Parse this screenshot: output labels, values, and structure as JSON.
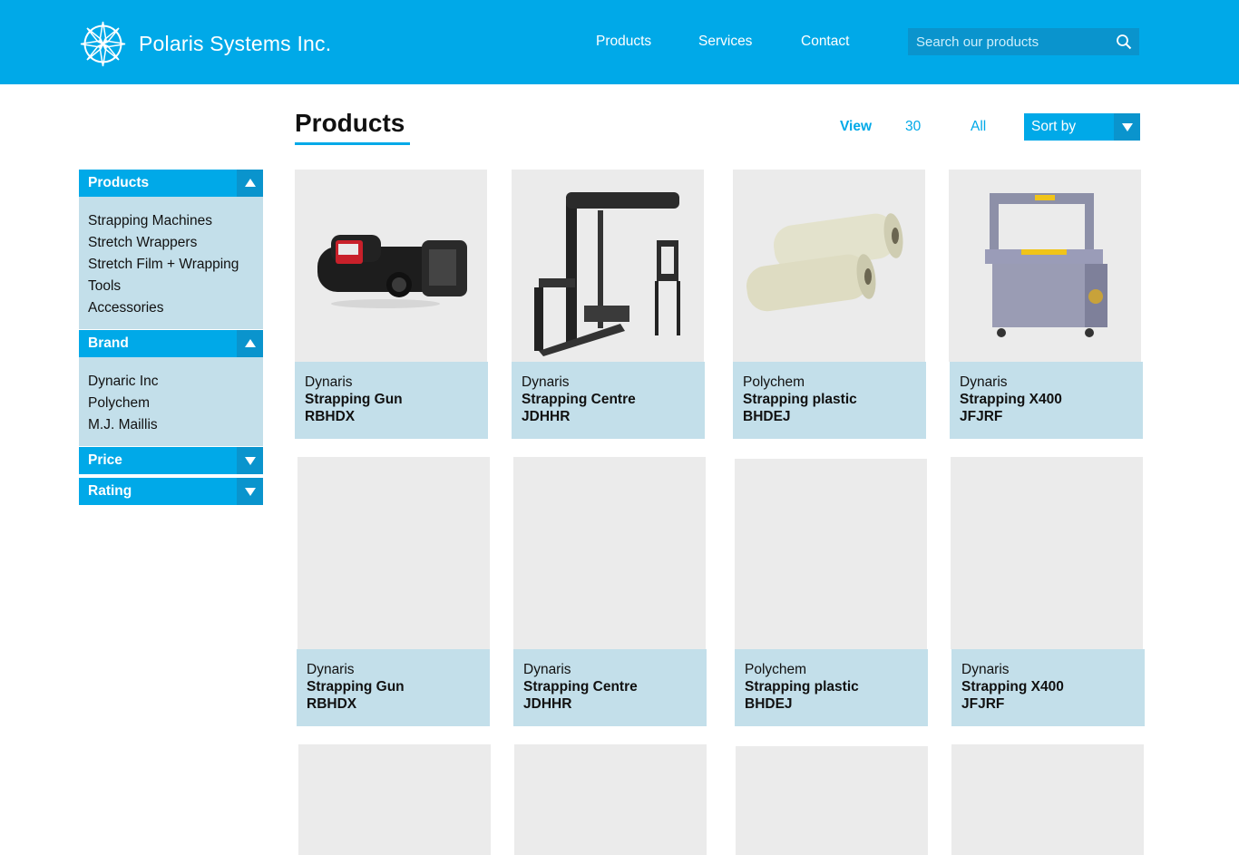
{
  "header": {
    "brand": "Polaris Systems Inc.",
    "nav": [
      "Products",
      "Services",
      "Contact"
    ],
    "search_placeholder": "Search our products",
    "bg_color": "#00a9e8"
  },
  "toolbar": {
    "title": "Products",
    "view_label": "View",
    "view_options": [
      "30",
      "All"
    ],
    "sort_label": "Sort by"
  },
  "filters": {
    "products": {
      "label": "Products",
      "items": [
        "Strapping Machines",
        "Stretch Wrappers",
        "Stretch Film + Wrapping",
        "Tools",
        "Accessories"
      ]
    },
    "brand": {
      "label": "Brand",
      "items": [
        "Dynaric Inc",
        "Polychem",
        "M.J. Maillis"
      ]
    },
    "price": {
      "label": "Price"
    },
    "rating": {
      "label": "Rating"
    }
  },
  "products": [
    {
      "brand": "Dynaris",
      "name": "Strapping Gun",
      "code": "RBHDX",
      "image": "strapping-gun"
    },
    {
      "brand": "Dynaris",
      "name": "Strapping Centre",
      "code": "JDHHR",
      "image": "stretch-wrapper"
    },
    {
      "brand": "Polychem",
      "name": "Strapping plastic",
      "code": "BHDEJ",
      "image": "film-rolls"
    },
    {
      "brand": "Dynaris",
      "name": "Strapping X400",
      "code": "JFJRF",
      "image": "strapping-machine"
    },
    {
      "brand": "Dynaris",
      "name": "Strapping Gun",
      "code": "RBHDX"
    },
    {
      "brand": "Dynaris",
      "name": "Strapping Centre",
      "code": "JDHHR"
    },
    {
      "brand": "Polychem",
      "name": "Strapping plastic",
      "code": "BHDEJ"
    },
    {
      "brand": "Dynaris",
      "name": "Strapping X400",
      "code": "JFJRF"
    }
  ]
}
